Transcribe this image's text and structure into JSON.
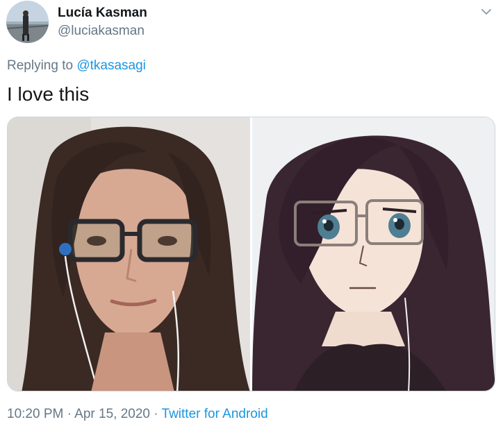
{
  "author": {
    "display_name": "Lucía Kasman",
    "handle": "@luciakasman"
  },
  "reply": {
    "prefix": "Replying to",
    "mention": "@tkasasagi"
  },
  "tweet": {
    "text": "I love this"
  },
  "meta": {
    "time": "10:20 PM",
    "separator": "·",
    "date": "Apr 15, 2020",
    "source": "Twitter for Android"
  },
  "colors": {
    "link": "#1b95e0",
    "secondary_text": "#657786",
    "primary_text": "#14171a",
    "border": "#ccd6dd"
  },
  "icons": {
    "menu": "chevron-down-icon"
  }
}
